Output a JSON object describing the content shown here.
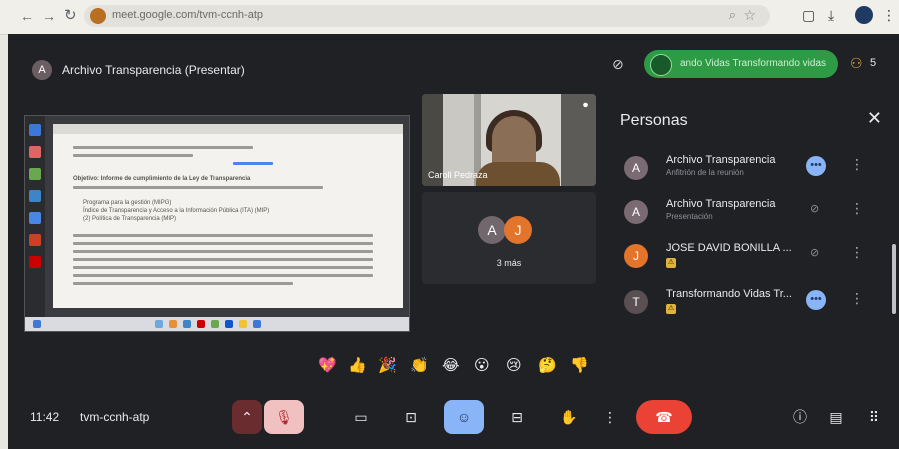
{
  "browser": {
    "url": "meet.google.com/tvm-ccnh-atp",
    "icons": [
      "back-arrow",
      "forward-arrow",
      "reload",
      "zoom",
      "star",
      "extensions",
      "download",
      "profile",
      "menu"
    ]
  },
  "meeting": {
    "presenter_initial": "A",
    "presenting_title": "Archivo Transparencia (Presentar)",
    "pill_text": "ando Vidas Transformando vidas",
    "participant_count": "5",
    "time": "11:42",
    "code": "tvm-ccnh-atp"
  },
  "shared_screen": {
    "heading_text": "Objetivo: Informe de cumplimiento de la Ley de Transparencia",
    "list_items": [
      "Programa para la gestión (MIPG)",
      "Índice de Transparencia y Acceso a la Información Pública (ITA) (MIP)",
      "(2) Política de Transparencia (MIP)"
    ]
  },
  "tiles": {
    "video_name": "Caroll Pedraza",
    "more_initials": [
      "A",
      "J"
    ],
    "more_label": "3 más"
  },
  "people_panel": {
    "title": "Personas",
    "participants": [
      {
        "initial": "A",
        "name": "Archivo Transparencia",
        "sub": "Anfitrión de la reunión",
        "color": "#7a6a71",
        "action": "dots"
      },
      {
        "initial": "A",
        "name": "Archivo Transparencia",
        "sub": "Presentación",
        "color": "#7a6a71",
        "action": "mic"
      },
      {
        "initial": "J",
        "name": "JOSE DAVID BONILLA ...",
        "sub": "",
        "color": "#e2742b",
        "action": "mic"
      },
      {
        "initial": "T",
        "name": "Transformando Vidas Tr...",
        "sub": "",
        "color": "#5a4f53",
        "action": "dots"
      }
    ]
  },
  "reactions": [
    "💖",
    "👍",
    "🎉",
    "👏",
    "😂",
    "😮",
    "😢",
    "🤔",
    "👎"
  ],
  "colors": {
    "meet_bg": "#202124",
    "leave_red": "#ea4335",
    "pill_green": "#2f9a46",
    "active_blue": "#8ab4f8"
  }
}
